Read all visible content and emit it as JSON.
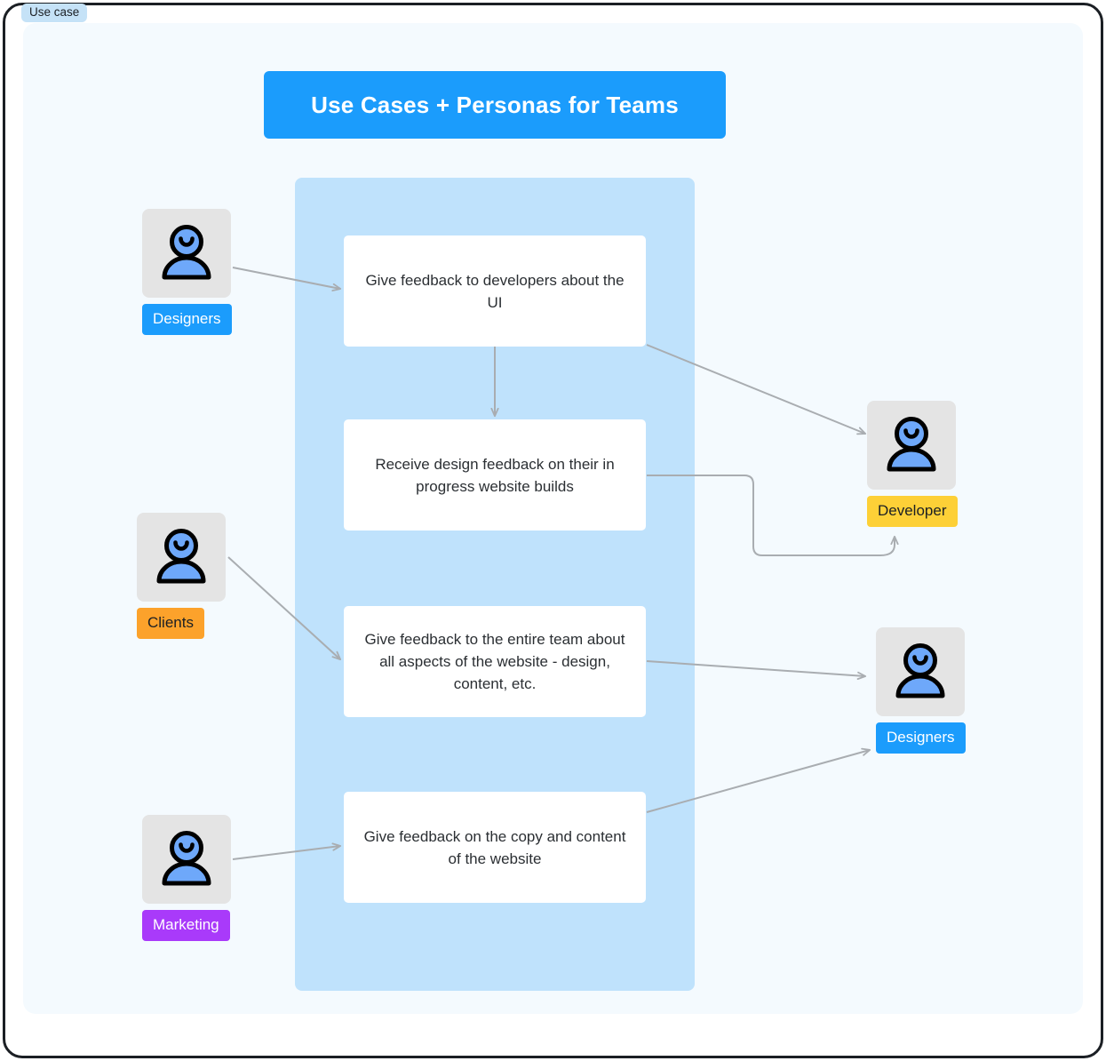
{
  "tag": {
    "label": "Use case"
  },
  "title": {
    "text": "Use Cases + Personas for Teams"
  },
  "colors": {
    "accent_blue": "#1b9cfc",
    "boundary_blue": "#bfe2fc",
    "canvas": "#f4fafe",
    "orange": "#fca22b",
    "yellow": "#fdd037",
    "purple": "#a93afa",
    "icon_bg": "#e4e4e4",
    "person_blue": "#6ea8fa",
    "connector": "#a9adb1"
  },
  "use_cases": [
    {
      "id": "uc1",
      "text": "Give feedback to developers about the UI"
    },
    {
      "id": "uc2",
      "text": "Receive design feedback on their in progress website builds"
    },
    {
      "id": "uc3",
      "text": "Give feedback to the entire team about all aspects of the website - design, content, etc."
    },
    {
      "id": "uc4",
      "text": "Give feedback on the copy and content of the website"
    }
  ],
  "actors": {
    "left": [
      {
        "id": "designers-left",
        "label": "Designers",
        "label_bg": "#1b9cfc",
        "label_color": "#ffffff"
      },
      {
        "id": "clients",
        "label": "Clients",
        "label_bg": "#fca22b",
        "label_color": "#1b1f24"
      },
      {
        "id": "marketing",
        "label": "Marketing",
        "label_bg": "#a93afa",
        "label_color": "#ffffff"
      }
    ],
    "right": [
      {
        "id": "developer",
        "label": "Developer",
        "label_bg": "#fdd037",
        "label_color": "#1b1f24"
      },
      {
        "id": "designers-right",
        "label": "Designers",
        "label_bg": "#1b9cfc",
        "label_color": "#ffffff"
      }
    ]
  },
  "connections": [
    {
      "from": "designers-left",
      "to": "uc1"
    },
    {
      "from": "uc1",
      "to": "uc2"
    },
    {
      "from": "uc1",
      "to": "developer-icon"
    },
    {
      "from": "uc2",
      "to": "developer-label"
    },
    {
      "from": "clients",
      "to": "uc3"
    },
    {
      "from": "uc3",
      "to": "designers-right-icon"
    },
    {
      "from": "marketing",
      "to": "uc4"
    },
    {
      "from": "uc4",
      "to": "designers-right-label"
    }
  ]
}
